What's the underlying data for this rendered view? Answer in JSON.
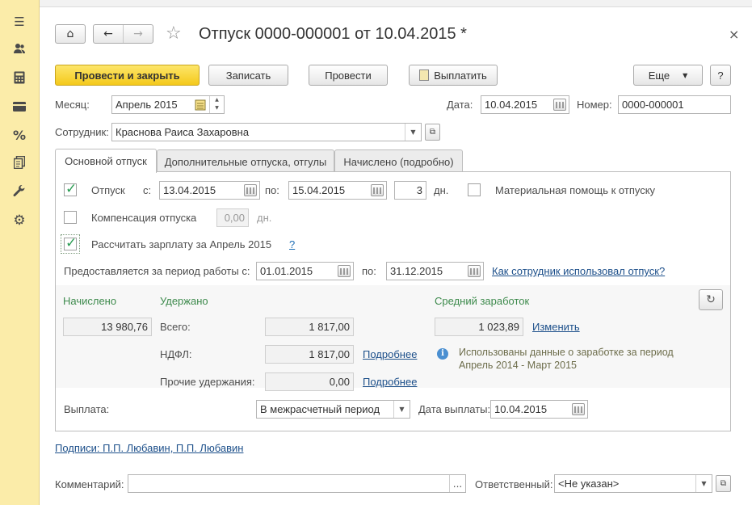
{
  "window": {
    "title": "Отпуск 0000-000001 от 10.04.2015 *"
  },
  "toolbar": {
    "post_close": "Провести и закрыть",
    "save": "Записать",
    "post": "Провести",
    "pay": "Выплатить",
    "more": "Еще",
    "help": "?"
  },
  "header": {
    "month_label": "Месяц:",
    "month_value": "Апрель 2015",
    "date_label": "Дата:",
    "date_value": "10.04.2015",
    "number_label": "Номер:",
    "number_value": "0000-000001",
    "employee_label": "Сотрудник:",
    "employee_value": "Краснова Раиса Захаровна"
  },
  "tabs": [
    {
      "label": "Основной отпуск",
      "active": true
    },
    {
      "label": "Дополнительные отпуска, отгулы",
      "active": false
    },
    {
      "label": "Начислено (подробно)",
      "active": false
    }
  ],
  "main_tab": {
    "vacation_label": "Отпуск",
    "vacation_checked": true,
    "from_label": "с:",
    "from_value": "13.04.2015",
    "to_label": "по:",
    "to_value": "15.04.2015",
    "days_value": "3",
    "days_unit": "дн.",
    "material_help_label": "Материальная помощь к отпуску",
    "material_help_checked": false,
    "compensation_label": "Компенсация отпуска",
    "compensation_checked": false,
    "compensation_days": "0,00",
    "compensation_unit": "дн.",
    "calc_salary_label": "Рассчитать зарплату за Апрель 2015",
    "calc_salary_checked": true,
    "calc_salary_help": "?",
    "period_label": "Предоставляется за период работы с:",
    "period_from": "01.01.2015",
    "period_to_label": "по:",
    "period_to": "31.12.2015",
    "usage_link": "Как сотрудник использовал отпуск?",
    "accrued_header": "Начислено",
    "accrued_value": "13 980,76",
    "withheld_header": "Удержано",
    "total_label": "Всего:",
    "total_value": "1 817,00",
    "ndfl_label": "НДФЛ:",
    "ndfl_value": "1 817,00",
    "ndfl_link": "Подробнее",
    "other_label": "Прочие удержания:",
    "other_value": "0,00",
    "other_link": "Подробнее",
    "avg_header": "Средний заработок",
    "avg_value": "1 023,89",
    "avg_change_link": "Изменить",
    "info_line1": "Использованы данные о заработке за период",
    "info_line2": "Апрель 2014 - Март 2015",
    "payout_label": "Выплата:",
    "payout_value": "В межрасчетный период",
    "payout_date_label": "Дата выплаты:",
    "payout_date_value": "10.04.2015"
  },
  "footer": {
    "signatures_link": "Подписи: П.П. Любавин, П.П. Любавин",
    "comment_label": "Комментарий:",
    "comment_value": "",
    "comment_btn": "...",
    "responsible_label": "Ответственный:",
    "responsible_value": "<Не указан>"
  },
  "colors": {
    "sidebar_bg": "#fbeca9",
    "primary_button": "#f4c91b",
    "section_header_green": "#3d8a4c",
    "link_blue": "#1c4f8a"
  },
  "sidebar": {
    "icons": [
      "menu-icon",
      "users-icon",
      "calculator-icon",
      "card-icon",
      "percent-icon",
      "documents-icon",
      "wrench-icon",
      "gear-icon"
    ]
  }
}
